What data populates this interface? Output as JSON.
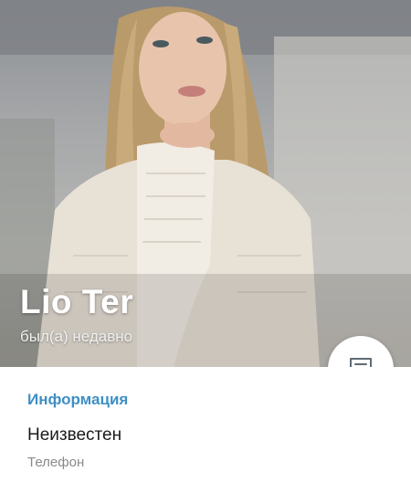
{
  "profile": {
    "name": "Lio Ter",
    "status": "был(а) недавно",
    "message_icon": "message-icon"
  },
  "info": {
    "section_title": "Информация",
    "phone_value": "Неизвестен",
    "phone_label": "Телефон"
  },
  "colors": {
    "accent": "#3f8fc4",
    "name_text": "#ffffff"
  }
}
